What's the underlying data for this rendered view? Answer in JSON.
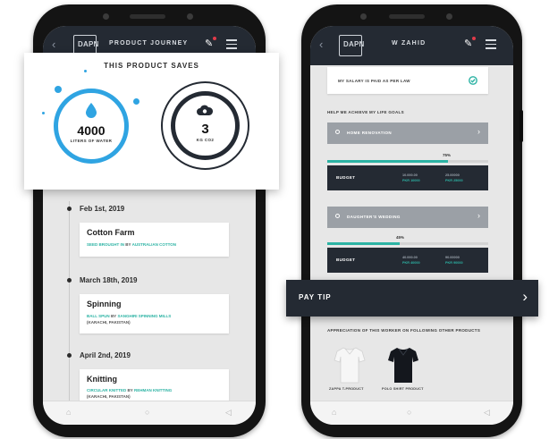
{
  "left_phone": {
    "header": {
      "back": "‹",
      "logo": "DAPN",
      "title": "PRODUCT JOURNEY"
    },
    "product_saves": {
      "heading": "THIS PRODUCT SAVES",
      "water": {
        "value": "4000",
        "unit": "LITERS OF WATER"
      },
      "co2": {
        "value": "3",
        "unit": "KG CO2"
      }
    },
    "timeline": [
      {
        "date": "Feb 1st, 2019",
        "title": "Cotton Farm",
        "line1_a": "SEED BROUGHT IN",
        "line1_b": "BY",
        "line1_c": "AUSTRALIAN COTTON",
        "line2": ""
      },
      {
        "date": "March 18th, 2019",
        "title": "Spinning",
        "line1_a": "BALL SPUN",
        "line1_b": "BY",
        "line1_c": "SANGHIRI SPINNING MILLS",
        "line2": "(KARACHI, PAKISTAN)"
      },
      {
        "date": "April 2nd, 2019",
        "title": "Knitting",
        "line1_a": "CIRCULAR KNITTED",
        "line1_b": "BY",
        "line1_c": "REHMAN KNITTING",
        "line2": "(KARACHI, PAKISTAN)"
      }
    ]
  },
  "right_phone": {
    "header": {
      "back": "‹",
      "logo": "DAPN",
      "title": "W ZAHID"
    },
    "salary_card": "MY SALARY IS PAID AS PER LAW",
    "goals_heading": "HELP ME ACHIEVE MY LIFE GOALS",
    "goals": [
      {
        "label": "HOME RENOVATION",
        "percent_label": "75%",
        "progress": 0.75,
        "row_label": "BUDGET",
        "col1_a": "10.000.00",
        "col1_b": "PKR 10000",
        "col2_a": "25.00000",
        "col2_b": "PKR 25000"
      },
      {
        "label": "DAUGHTER'S WEDDING",
        "percent_label": "45%",
        "progress": 0.45,
        "row_label": "BUDGET",
        "col1_a": "40.000.00",
        "col1_b": "PKR 40000",
        "col2_a": "90.00000",
        "col2_b": "PKR 90000"
      }
    ],
    "pay_tip": "PAY TIP",
    "appreciation": "APPRECIATION OF THIS WORKER ON FOLLOWING OTHER PRODUCTS",
    "products": [
      "ZAPPA T-PRODUCT",
      "POLO SHIRT PRODUCT"
    ]
  },
  "bottom_nav": {
    "home": "⌂",
    "middle": "○",
    "back": "◁"
  },
  "colors": {
    "accent_blue": "#2fa4e2",
    "accent_teal": "#2cb3a4",
    "navy": "#242a33"
  }
}
